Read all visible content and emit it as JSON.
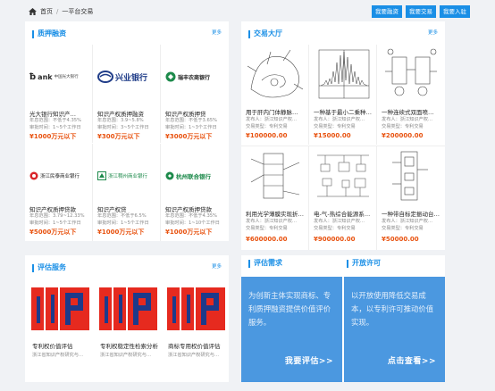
{
  "breadcrumb": {
    "home": "首页",
    "separator": "/",
    "current": "一平台交易"
  },
  "top_buttons": [
    "我要融资",
    "我要交易",
    "我要入驻"
  ],
  "pledge": {
    "title": "质押融资",
    "more": "更多",
    "items": [
      {
        "logo_text": "中国光大银行",
        "name": "光大银行知识产…",
        "rate": "年息范围：不低于4.35%",
        "term": "审批时间：1~5个工作日",
        "price": "¥1000万元以下"
      },
      {
        "logo_text": "兴业银行",
        "name": "知识产权质押融资",
        "rate": "年息范围：3.9~5.8%",
        "term": "审批时间：3~5个工作日",
        "price": "¥300万元以下"
      },
      {
        "logo_text": "瑞丰农商银行",
        "name": "知识产权质押贷",
        "rate": "年息范围：不低于3.65%",
        "term": "审批时间：1~3个工作日",
        "price": "¥3000万元以下"
      },
      {
        "logo_text": "浙江民泰商业银行",
        "name": "知识产权质押贷款",
        "rate": "年息范围：3.79~12.33%",
        "term": "审批时间：1~5个工作日",
        "price": "¥5000万元以下"
      },
      {
        "logo_text": "浙江稠州商业银行",
        "name": "知识产权贷",
        "rate": "年息范围：不低于6.5%",
        "term": "审批时间：1~5个工作日",
        "price": "¥1000万元以下"
      },
      {
        "logo_text": "杭州联合银行",
        "name": "知识产权质押贷款",
        "rate": "年息范围：不低于4.35%",
        "term": "审批时间：1~10个工作日",
        "price": "¥1000万元以下"
      }
    ]
  },
  "trade": {
    "title": "交易大厅",
    "more": "更多",
    "items": [
      {
        "name": "用于肝内门体静脉…",
        "publisher": "发布人：浙江知识产权…",
        "type": "交易类型：专利交易",
        "price": "¥100000.00"
      },
      {
        "name": "一种基于最小二乘种…",
        "publisher": "发布人：浙江知识产权…",
        "type": "交易类型：专利交易",
        "price": "¥15000.00"
      },
      {
        "name": "一种连续式双面喷…",
        "publisher": "发布人：浙江知识产权…",
        "type": "交易类型：专利交易",
        "price": "¥200000.00"
      },
      {
        "name": "利用光学薄膜实现折…",
        "publisher": "发布人：浙江知识产权…",
        "type": "交易类型：专利交易",
        "price": "¥600000.00"
      },
      {
        "name": "电-气-热综合能源系…",
        "publisher": "发布人：浙江知识产权…",
        "type": "交易类型：专利交易",
        "price": "¥900000.00"
      },
      {
        "name": "一种带自标定振动台…",
        "publisher": "发布人：浙江知识产权…",
        "type": "交易类型：专利交易",
        "price": "¥50000.00"
      }
    ]
  },
  "evaluation": {
    "title": "评估服务",
    "more": "更多",
    "items": [
      {
        "name": "专利权价值评估",
        "org": "浙江省知识产权研究与…"
      },
      {
        "name": "专利权稳定性检索分析",
        "org": "浙江省知识产权研究与…"
      },
      {
        "name": "商标专用权价值评估",
        "org": "浙江省知识产权研究与…"
      }
    ]
  },
  "demand": {
    "title": "评估需求",
    "text": "为创新主体实现商标、专利质押融资提供价值评价服务。",
    "action": "我要评估>>"
  },
  "license": {
    "title": "开放许可",
    "text": "以开放使用降低交易成本，以专利许可推动价值实现。",
    "action": "点击查看>>"
  },
  "colors": {
    "accent": "#1a8fe6",
    "price": "#e8520f",
    "card_blue": "#4b98e0"
  }
}
